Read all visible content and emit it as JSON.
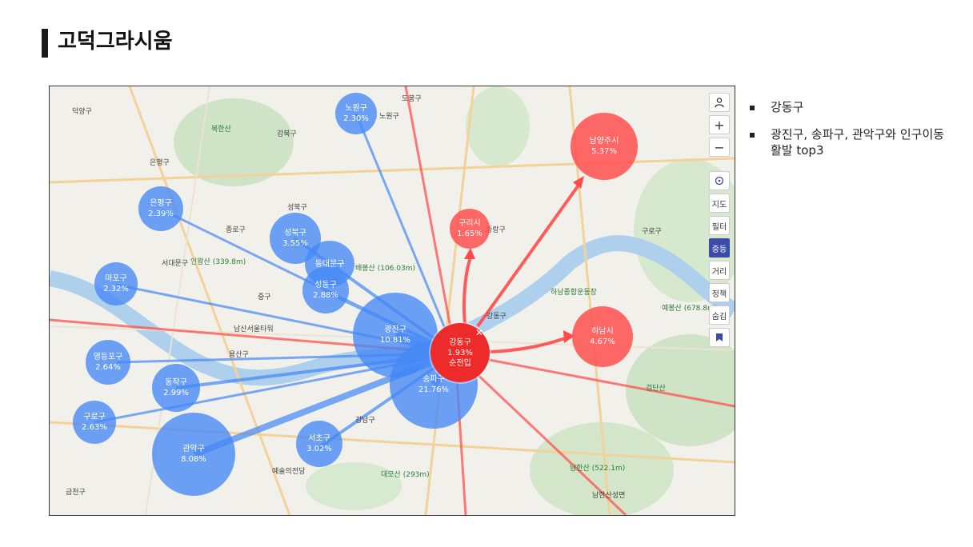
{
  "title": "고덕그라시움",
  "bullets": [
    "강동구",
    "광진구, 송파구, 관악구와 인구이동 활발 top3"
  ],
  "colors": {
    "inflow": "#4488f6",
    "outflow": "#ff5050",
    "center": "#ee2b2b"
  },
  "center": {
    "name": "강동구",
    "value": "1.93%",
    "label": "순전입"
  },
  "inflow_regions": [
    {
      "name": "노원구",
      "value": "2.30%"
    },
    {
      "name": "은평구",
      "value": "2.39%"
    },
    {
      "name": "성북구",
      "value": "3.55%"
    },
    {
      "name": "동대문구",
      "value": ""
    },
    {
      "name": "성동구",
      "value": "2.88%"
    },
    {
      "name": "마포구",
      "value": "2.32%"
    },
    {
      "name": "광진구",
      "value": "10.81%"
    },
    {
      "name": "송파구",
      "value": "21.76%"
    },
    {
      "name": "영등포구",
      "value": "2.64%"
    },
    {
      "name": "동작구",
      "value": "2.99%"
    },
    {
      "name": "구로구",
      "value": "2.63%"
    },
    {
      "name": "관악구",
      "value": "8.08%"
    },
    {
      "name": "서초구",
      "value": "3.02%"
    }
  ],
  "outflow_regions": [
    {
      "name": "남양주시",
      "value": "5.37%"
    },
    {
      "name": "구리시",
      "value": "1.65%"
    },
    {
      "name": "하남시",
      "value": "4.67%"
    }
  ],
  "toolbar": {
    "user_icon": "person-icon",
    "zoom_in": "+",
    "zoom_out": "−",
    "locate_icon": "crosshair-icon",
    "map": "지도",
    "filter": "필터",
    "join": "중등",
    "distance": "거리",
    "policy": "정책",
    "hide": "숨김",
    "bookmark_icon": "bookmark-icon"
  },
  "places": [
    "덕양구",
    "은평구",
    "종로구",
    "서대문구",
    "중구",
    "용산구",
    "강북구",
    "성북구",
    "도봉구",
    "노원구",
    "중랑구",
    "광진구",
    "강동구",
    "송파구",
    "강남구",
    "서초구",
    "관악구",
    "금천구",
    "동작구",
    "영등포구",
    "구로구",
    "하남시",
    "와부읍",
    "남양주시",
    "구리시",
    "북한산",
    "수락산",
    "인왕산 (339.8m)",
    "배봉산 (106.03m)",
    "예봉산 (678.8m)",
    "대모산 (293m)",
    "남한산 (522.1m)",
    "검단산",
    "남한산성면",
    "예술의전당",
    "서울역",
    "남산서울타워",
    "하남종합운동장",
    "우면산 (293m)",
    "구룡산 (306m)"
  ]
}
